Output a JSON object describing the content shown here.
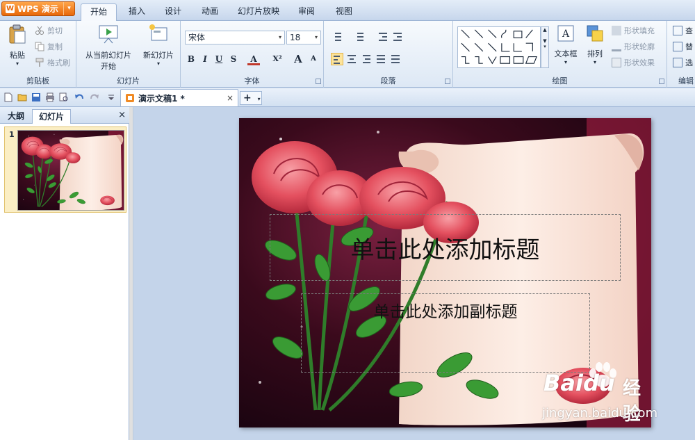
{
  "app": {
    "menu_label": "WPS 演示"
  },
  "ribbon_tabs": [
    {
      "label": "开始",
      "active": true
    },
    {
      "label": "插入"
    },
    {
      "label": "设计"
    },
    {
      "label": "动画"
    },
    {
      "label": "幻灯片放映"
    },
    {
      "label": "审阅"
    },
    {
      "label": "视图"
    }
  ],
  "clipboard": {
    "paste": "粘贴",
    "cut": "剪切",
    "copy": "复制",
    "format_painter": "格式刷",
    "group_label": "剪贴板"
  },
  "slides_group": {
    "from_current_line1": "从当前幻灯片",
    "from_current_line2": "开始",
    "new_slide": "新幻灯片",
    "group_label": "幻灯片"
  },
  "font_group": {
    "font_name": "宋体",
    "font_size": "18",
    "bold": "B",
    "italic": "I",
    "underline": "U",
    "strike": "S",
    "font_color": "A",
    "superscript": "X²",
    "grow": "A",
    "shrink": "A",
    "group_label": "字体"
  },
  "paragraph_group": {
    "group_label": "段落"
  },
  "drawing_group": {
    "textbox": "文本框",
    "arrange": "排列",
    "shape_fill": "形状填充",
    "shape_outline": "形状轮廓",
    "shape_effect": "形状效果",
    "group_label": "绘图"
  },
  "edit_group": {
    "find": "查",
    "replace": "替",
    "select": "选",
    "group_label": "编辑"
  },
  "document_tab": {
    "title": "演示文稿1 *",
    "close": "×"
  },
  "new_tab": {
    "label": "+"
  },
  "left_panel": {
    "tab_outline": "大纲",
    "tab_slides": "幻灯片",
    "close": "×",
    "slide_number": "1"
  },
  "slide": {
    "title_placeholder": "单击此处添加标题",
    "subtitle_placeholder": "单击此处添加副标题"
  },
  "watermark": {
    "brand": "Baidu",
    "jingyan": "经验",
    "url": "jingyan.baidu.com"
  }
}
